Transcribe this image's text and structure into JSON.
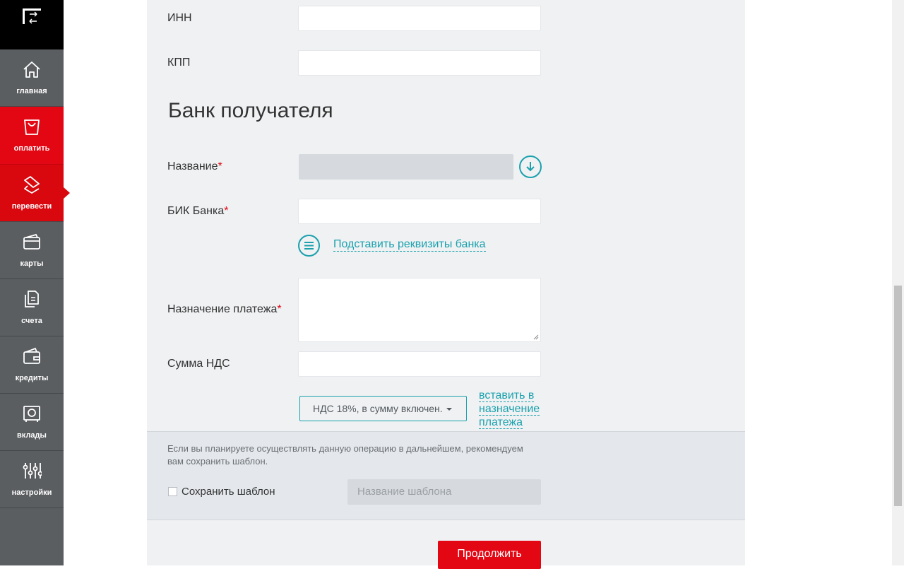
{
  "sidebar": {
    "items": [
      {
        "label": "главная",
        "icon": "home-icon"
      },
      {
        "label": "оплатить",
        "icon": "shopping-bag-icon"
      },
      {
        "label": "перевести",
        "icon": "transfer-icon"
      },
      {
        "label": "карты",
        "icon": "card-icon"
      },
      {
        "label": "счета",
        "icon": "documents-icon"
      },
      {
        "label": "кредиты",
        "icon": "wallet-icon"
      },
      {
        "label": "вклады",
        "icon": "safe-icon"
      },
      {
        "label": "настройки",
        "icon": "sliders-icon"
      }
    ],
    "active_item": "перевести"
  },
  "form": {
    "inn_label": "ИНН",
    "kpp_label": "КПП",
    "bank_section_title": "Банк получателя",
    "bank_name_label": "Название",
    "bik_label": "БИК Банка",
    "fill_bank_details_link": "Подставить реквизиты банка",
    "payment_purpose_label": "Назначение платежа",
    "vat_amount_label": "Сумма НДС",
    "vat_select_value": "НДС 18%, в сумму включен.",
    "insert_vat_link": "вставить в назначение платежа",
    "required_mark": "*"
  },
  "template": {
    "hint": "Если вы планируете осуществлять данную операцию в дальнейшем, рекомендуем вам сохранить шаблон.",
    "save_label": "Сохранить шаблон",
    "name_placeholder": "Название шаблона"
  },
  "actions": {
    "continue_label": "Продолжить"
  },
  "colors": {
    "brand_red": "#e30613",
    "accent_teal": "#1ba1ad",
    "sidebar_bg": "#5b5e61"
  }
}
